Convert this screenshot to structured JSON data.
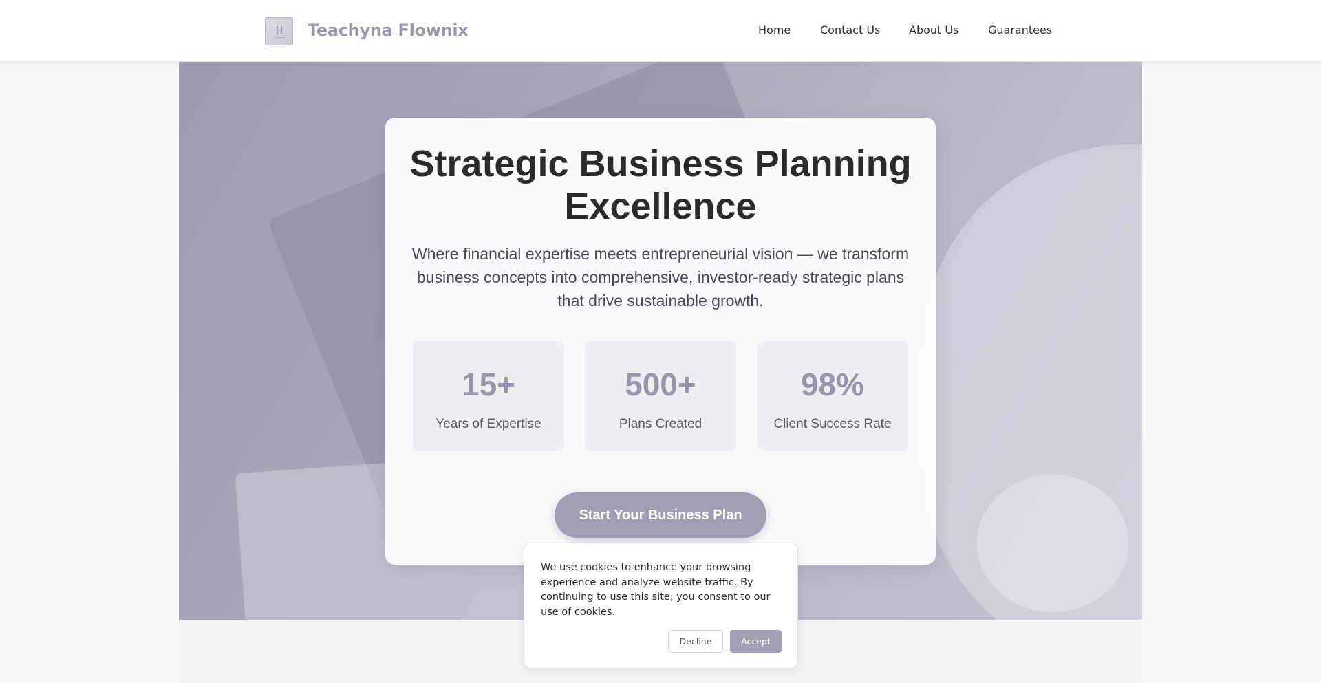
{
  "header": {
    "brand": "Teachyna Flownix",
    "logo_icon": "company-logo-icon",
    "nav": [
      "Home",
      "Contact Us",
      "About Us",
      "Guarantees"
    ]
  },
  "hero": {
    "title": "Strategic Business Planning Excellence",
    "subtitle": "Where financial expertise meets entrepreneurial vision — we transform business concepts into comprehensive, investor-ready strategic plans that drive sustainable growth.",
    "stats": [
      {
        "value": "15+",
        "label": "Years of Expertise"
      },
      {
        "value": "500+",
        "label": "Plans Created"
      },
      {
        "value": "98%",
        "label": "Client Success Rate"
      }
    ],
    "cta_label": "Start Your Business Plan"
  },
  "cookie": {
    "text": "We use cookies to enhance your browsing experience and analyze website traffic. By continuing to use this site, you consent to our use of cookies.",
    "decline_label": "Decline",
    "accept_label": "Accept"
  },
  "colors": {
    "accent": "#a09eb3",
    "brand_text": "#9a98ad",
    "title_text": "#2b2b2e"
  }
}
